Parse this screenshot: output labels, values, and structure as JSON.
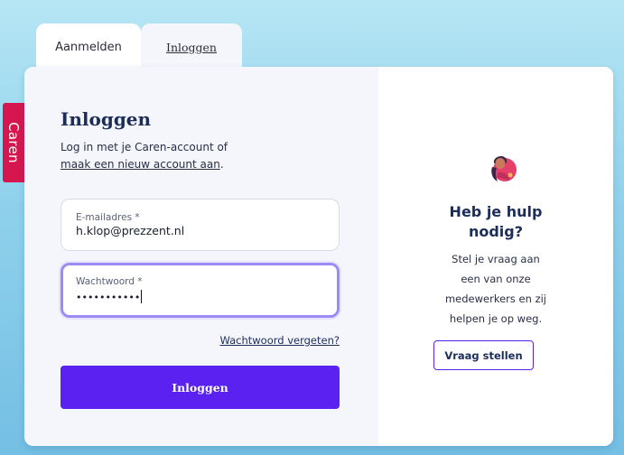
{
  "brand": {
    "name": "Caren",
    "color": "#d6164e"
  },
  "tabs": [
    {
      "label": "Aanmelden",
      "active": false
    },
    {
      "label": "Inloggen",
      "active": true
    }
  ],
  "login": {
    "title": "Inloggen",
    "intro_text": "Log in met je Caren-account of",
    "create_account_link": "maak een nieuw account aan",
    "intro_suffix": ".",
    "email": {
      "label": "E-mailadres *",
      "value": "h.klop@prezzent.nl"
    },
    "password": {
      "label": "Wachtwoord *",
      "value": "•••••••••••",
      "focused": true
    },
    "forgot_link": "Wachtwoord vergeten?",
    "submit_label": "Inloggen",
    "accent_color": "#5a21f0"
  },
  "help": {
    "icon": "support-person-icon",
    "title_line1": "Heb je hulp",
    "title_line2": "nodig?",
    "text_line1": "Stel je vraag aan",
    "text_line2": "een van onze",
    "text_line3": "medewerkers en zij",
    "text_line4": "helpen je op weg.",
    "button_label": "Vraag stellen"
  }
}
